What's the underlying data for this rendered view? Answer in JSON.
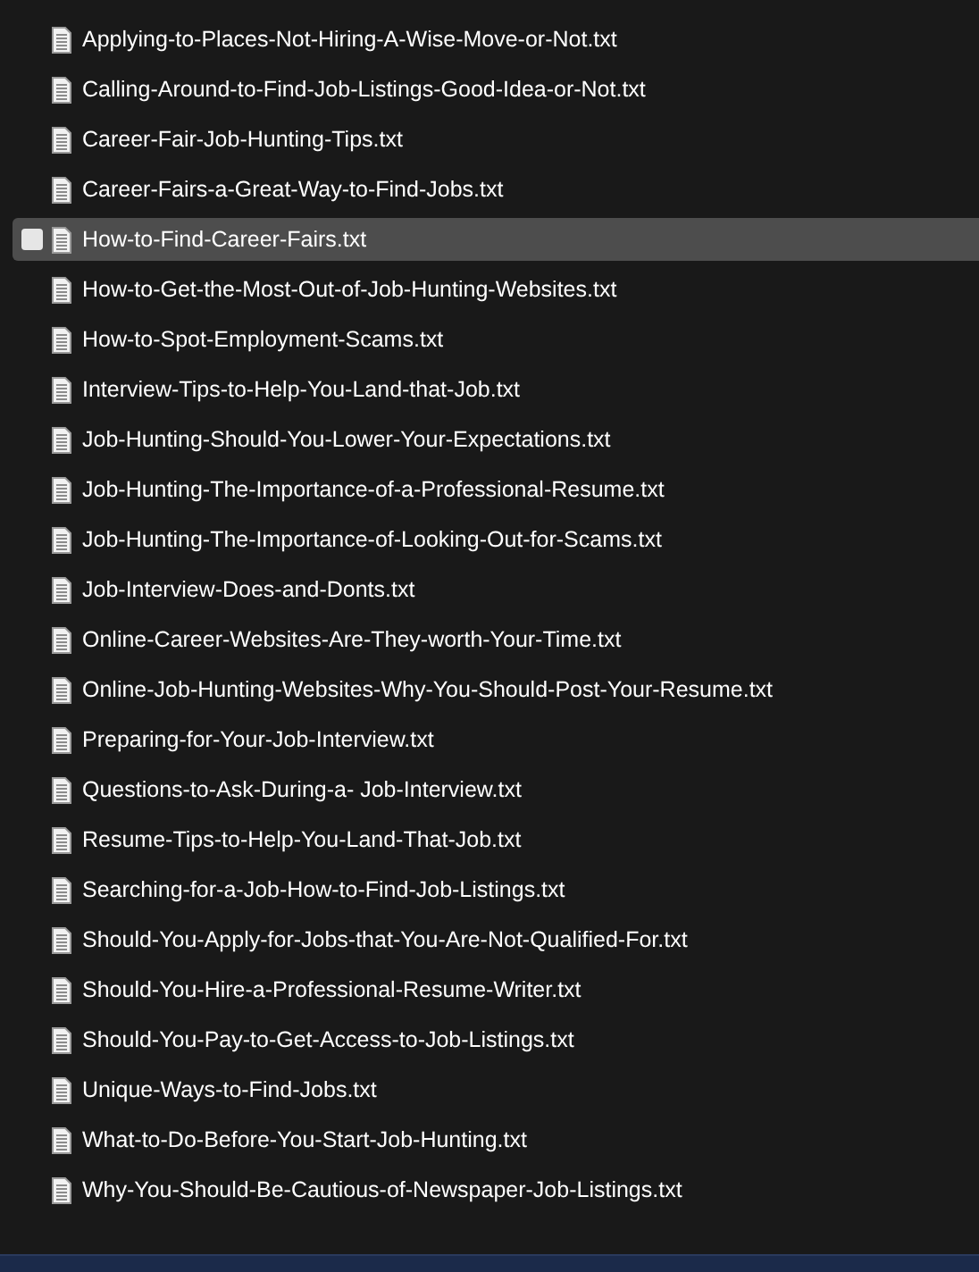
{
  "files": [
    {
      "name": "Applying-to-Places-Not-Hiring-A-Wise-Move-or-Not.txt",
      "selected": false
    },
    {
      "name": "Calling-Around-to-Find-Job-Listings-Good-Idea-or-Not.txt",
      "selected": false
    },
    {
      "name": "Career-Fair-Job-Hunting-Tips.txt",
      "selected": false
    },
    {
      "name": "Career-Fairs-a-Great-Way-to-Find-Jobs.txt",
      "selected": false
    },
    {
      "name": "How-to-Find-Career-Fairs.txt",
      "selected": true
    },
    {
      "name": "How-to-Get-the-Most-Out-of-Job-Hunting-Websites.txt",
      "selected": false
    },
    {
      "name": "How-to-Spot-Employment-Scams.txt",
      "selected": false
    },
    {
      "name": "Interview-Tips-to-Help-You-Land-that-Job.txt",
      "selected": false
    },
    {
      "name": "Job-Hunting-Should-You-Lower-Your-Expectations.txt",
      "selected": false
    },
    {
      "name": "Job-Hunting-The-Importance-of-a-Professional-Resume.txt",
      "selected": false
    },
    {
      "name": "Job-Hunting-The-Importance-of-Looking-Out-for-Scams.txt",
      "selected": false
    },
    {
      "name": "Job-Interview-Does-and-Donts.txt",
      "selected": false
    },
    {
      "name": "Online-Career-Websites-Are-They-worth-Your-Time.txt",
      "selected": false
    },
    {
      "name": "Online-Job-Hunting-Websites-Why-You-Should-Post-Your-Resume.txt",
      "selected": false
    },
    {
      "name": "Preparing-for-Your-Job-Interview.txt",
      "selected": false
    },
    {
      "name": "Questions-to-Ask-During-a- Job-Interview.txt",
      "selected": false
    },
    {
      "name": "Resume-Tips-to-Help-You-Land-That-Job.txt",
      "selected": false
    },
    {
      "name": "Searching-for-a-Job-How-to-Find-Job-Listings.txt",
      "selected": false
    },
    {
      "name": "Should-You-Apply-for-Jobs-that-You-Are-Not-Qualified-For.txt",
      "selected": false
    },
    {
      "name": "Should-You-Hire-a-Professional-Resume-Writer.txt",
      "selected": false
    },
    {
      "name": "Should-You-Pay-to-Get-Access-to-Job-Listings.txt",
      "selected": false
    },
    {
      "name": "Unique-Ways-to-Find-Jobs.txt",
      "selected": false
    },
    {
      "name": "What-to-Do-Before-You-Start-Job-Hunting.txt",
      "selected": false
    },
    {
      "name": "Why-You-Should-Be-Cautious-of-Newspaper-Job-Listings.txt",
      "selected": false
    }
  ]
}
